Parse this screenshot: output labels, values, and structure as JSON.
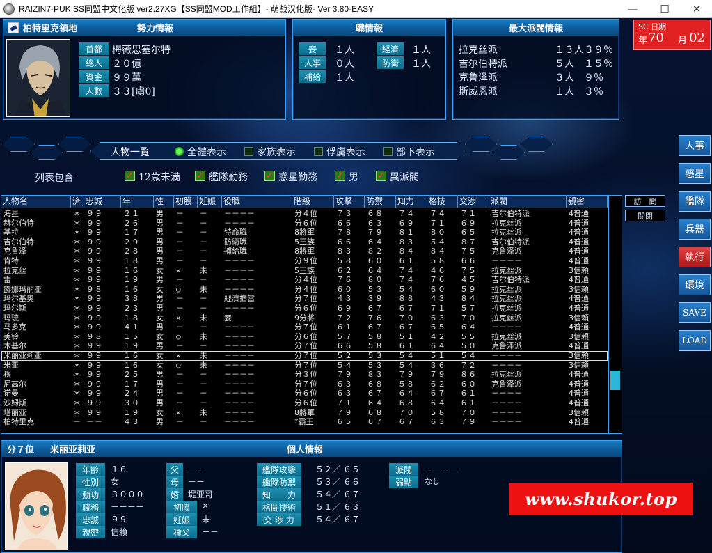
{
  "window": {
    "title": "RAIZIN7-PUK SS同盟中文化版   ver2.27XG【SS同盟MOD工作組】- 萌战汉化版- Ver 3.80-EASY",
    "minimize": "—",
    "maximize": "☐",
    "close": "✕"
  },
  "territory_panel": {
    "planet_name": "柏特里克領地",
    "header": "勢力情報",
    "labels": [
      "首都",
      "總人",
      "資金",
      "人數"
    ],
    "values": [
      "梅薇思塞尔特",
      "２０億",
      "９９萬",
      "３３[虜0]"
    ]
  },
  "post_panel": {
    "header": "職情報",
    "items": [
      {
        "label": "妾",
        "value": "１人"
      },
      {
        "label": "經濟",
        "value": "１人"
      },
      {
        "label": "人事",
        "value": "０人"
      },
      {
        "label": "防衛",
        "value": "１人"
      },
      {
        "label": "補給",
        "value": "１人"
      }
    ]
  },
  "faction_panel": {
    "header": "最大派閥情報",
    "rows": [
      {
        "name": "拉克丝派",
        "count": "１３人",
        "pct": "３９％"
      },
      {
        "name": "吉尔伯特派",
        "count": "５人",
        "pct": "１５％"
      },
      {
        "name": "克鲁泽派",
        "count": "３人",
        "pct": "９％"
      },
      {
        "name": "斯威恩派",
        "count": "１人",
        "pct": "３％"
      }
    ]
  },
  "date": {
    "label": "SC 日期",
    "year_label": "年",
    "year": "70",
    "month_label": "月",
    "month": "02"
  },
  "nav": {
    "title": "人物一覧",
    "options": [
      {
        "label": "全體表示",
        "on": true
      },
      {
        "label": "家族表示",
        "on": false
      },
      {
        "label": "俘虜表示",
        "on": false
      },
      {
        "label": "部下表示",
        "on": false
      }
    ]
  },
  "filters": {
    "label": "列表包含",
    "items": [
      "12歳未満",
      "艦隊勤務",
      "惑星勤務",
      "男",
      "異派閥"
    ]
  },
  "table": {
    "headers": [
      "人物名",
      "済",
      "忠誠",
      "年",
      "性",
      "初膜",
      "妊娠",
      "役職",
      "階級",
      "攻撃",
      "防禦",
      "知力",
      "格技",
      "交渉",
      "派閥",
      "親密"
    ],
    "rows": [
      [
        "海星",
        "＊",
        "９９",
        "２１",
        "男",
        "－",
        "－",
        "－－－－",
        "分４位",
        "７３",
        "６８",
        "７４",
        "７４",
        "７１",
        "吉尔伯特派",
        "4普通"
      ],
      [
        "赫尔伯特",
        "＊",
        "９９",
        "２６",
        "男",
        "－",
        "－",
        "－－－－",
        "分６位",
        "６６",
        "６３",
        "６９",
        "７１",
        "６９",
        "拉克丝派",
        "4普通"
      ],
      [
        "基拉",
        "＊",
        "９９",
        "１７",
        "男",
        "－",
        "－",
        "特命職",
        "8將軍",
        "７８",
        "７９",
        "８１",
        "８０",
        "６５",
        "拉克丝派",
        "4普通"
      ],
      [
        "吉尔伯特",
        "＊",
        "９９",
        "２９",
        "男",
        "－",
        "－",
        "防衛職",
        "5王族",
        "６６",
        "６４",
        "８３",
        "５４",
        "８７",
        "吉尔伯特派",
        "4普通"
      ],
      [
        "克鲁泽",
        "＊",
        "９９",
        "２８",
        "男",
        "－",
        "－",
        "補給職",
        "8將軍",
        "８３",
        "８２",
        "８４",
        "８４",
        "７５",
        "克鲁泽派",
        "4普通"
      ],
      [
        "肯特",
        "＊",
        "９９",
        "１８",
        "男",
        "－",
        "－",
        "－－－－",
        "分９位",
        "５８",
        "６０",
        "６１",
        "５８",
        "６６",
        "－－－－",
        "4普通"
      ],
      [
        "拉克丝",
        "＊",
        "９９",
        "１６",
        "女",
        "×",
        "未",
        "－－－－",
        "5王族",
        "６２",
        "６４",
        "７４",
        "４６",
        "７５",
        "拉克丝派",
        "3信頼"
      ],
      [
        "雷",
        "＊",
        "９９",
        "１９",
        "男",
        "－",
        "－",
        "－－－－",
        "分４位",
        "７６",
        "８０",
        "７４",
        "７６",
        "４５",
        "吉尔伯特派",
        "4普通"
      ],
      [
        "露娜玛丽亚",
        "＊",
        "９８",
        "１６",
        "女",
        "○",
        "未",
        "－－－－",
        "分４位",
        "６０",
        "５３",
        "５４",
        "６０",
        "５９",
        "拉克丝派",
        "3信頼"
      ],
      [
        "玛尔基奥",
        "＊",
        "９９",
        "３８",
        "男",
        "－",
        "－",
        "經濟擔當",
        "分７位",
        "４３",
        "３９",
        "８８",
        "４３",
        "８４",
        "拉克丝派",
        "4普通"
      ],
      [
        "玛尔斯",
        "＊",
        "９９",
        "２３",
        "男",
        "－",
        "－",
        "－－－－",
        "分６位",
        "６９",
        "６７",
        "６７",
        "７１",
        "５７",
        "拉克丝派",
        "4普通"
      ],
      [
        "玛琉",
        "＊",
        "９９",
        "１８",
        "女",
        "×",
        "未",
        "妾",
        "9分將",
        "７２",
        "７６",
        "７０",
        "６３",
        "７０",
        "拉克丝派",
        "3信頼"
      ],
      [
        "马多克",
        "＊",
        "９９",
        "４１",
        "男",
        "－",
        "－",
        "－－－－",
        "分７位",
        "６１",
        "６７",
        "６７",
        "６５",
        "６４",
        "－－－－",
        "4普通"
      ],
      [
        "美铃",
        "＊",
        "９８",
        "１５",
        "女",
        "○",
        "未",
        "－－－－",
        "分６位",
        "５７",
        "５８",
        "５１",
        "４２",
        "５５",
        "拉克丝派",
        "3信頼"
      ],
      [
        "木基尔",
        "＊",
        "９９",
        "１９",
        "男",
        "－",
        "－",
        "－－－－",
        "分７位",
        "６６",
        "５８",
        "６１",
        "６４",
        "５０",
        "克鲁泽派",
        "4普通"
      ],
      [
        "米丽亚莉亚",
        "＊",
        "９９",
        "１６",
        "女",
        "×",
        "未",
        "－－－－",
        "分７位",
        "５２",
        "５３",
        "５４",
        "５１",
        "５４",
        "－－－－",
        "3信頼"
      ],
      [
        "米亚",
        "＊",
        "９９",
        "１６",
        "女",
        "○",
        "未",
        "－－－－",
        "分７位",
        "５４",
        "５３",
        "５４",
        "３６",
        "７２",
        "－－－－",
        "3信頼"
      ],
      [
        "穆",
        "＊",
        "９９",
        "２５",
        "男",
        "－",
        "－",
        "－－－－",
        "分３位",
        "７９",
        "８３",
        "７９",
        "７９",
        "８６",
        "拉克丝派",
        "4普通"
      ],
      [
        "尼高尔",
        "＊",
        "９９",
        "１７",
        "男",
        "－",
        "－",
        "－－－－",
        "分７位",
        "６３",
        "６８",
        "５８",
        "６２",
        "６０",
        "克鲁泽派",
        "4普通"
      ],
      [
        "诺曼",
        "＊",
        "９９",
        "２４",
        "男",
        "－",
        "－",
        "－－－－",
        "分６位",
        "６３",
        "６７",
        "６４",
        "６７",
        "６１",
        "－－－－",
        "4普通"
      ],
      [
        "沙姆斯",
        "＊",
        "９９",
        "３０",
        "男",
        "－",
        "－",
        "－－－－",
        "分６位",
        "７１",
        "６４",
        "６８",
        "６４",
        "６１",
        "－－－－",
        "4普通"
      ],
      [
        "塔丽亚",
        "＊",
        "９９",
        "１９",
        "女",
        "×",
        "未",
        "－－－－",
        "8將軍",
        "７９",
        "６８",
        "７０",
        "５８",
        "７０",
        "－－－－",
        "3信頼"
      ],
      [
        "柏特里克",
        "－",
        "－－",
        "４３",
        "男",
        "－",
        "－",
        "－－－－",
        "*霸王",
        "６５",
        "６７",
        "６７",
        "６３",
        "７９",
        "－－－－",
        "4普通"
      ]
    ],
    "selected_index": 15
  },
  "side_small": [
    "訪　問",
    "關閉"
  ],
  "side_menu": [
    "人事",
    "惑星",
    "艦隊",
    "兵器",
    "執行",
    "環境",
    "SAVE",
    "LOAD"
  ],
  "personal": {
    "rank": "分７位",
    "name": "米丽亚莉亚",
    "header": "個人情報",
    "left_labels": [
      "年齡",
      "性別",
      "勳功",
      "職務",
      "忠誠",
      "親密"
    ],
    "left_values": [
      "１６",
      "女",
      "３０００",
      "－－－－",
      "９９",
      "信賴"
    ],
    "mid_labels": [
      "父",
      "母",
      "婚",
      "初膜",
      "妊娠",
      "種父"
    ],
    "mid_values": [
      "－－",
      "－－",
      "堤亚哥",
      "×",
      "未",
      "－－"
    ],
    "stat_labels": [
      "艦隊攻擊",
      "艦隊防禦",
      "知　　力",
      "格鬪技術",
      "交 涉 力"
    ],
    "stat_values": [
      "５２／ ６５",
      "５３／ ６６",
      "５４／ ６７",
      "５１／ ６３",
      "５４／ ６７"
    ],
    "right_labels": [
      "派閥",
      "弱點"
    ],
    "right_values": [
      "－－－－",
      "なし"
    ]
  },
  "watermark": "www.shukor.top"
}
